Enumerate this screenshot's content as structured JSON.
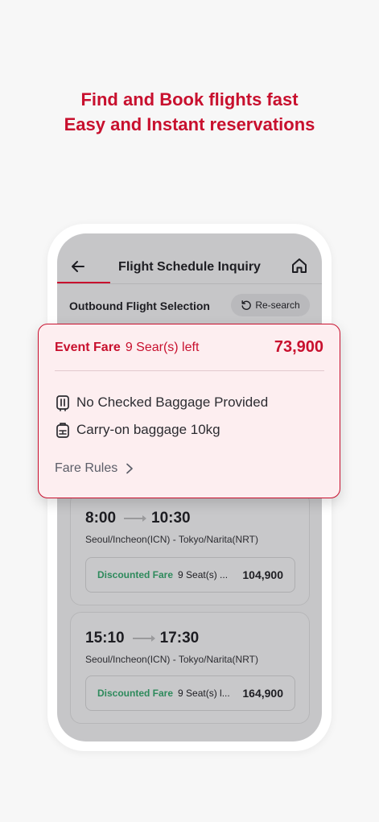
{
  "headline": {
    "line1": "Find and Book flights fast",
    "line2": "Easy and Instant reservations"
  },
  "appbar": {
    "title": "Flight Schedule Inquiry",
    "back_icon": "arrow-left-icon",
    "home_icon": "home-icon"
  },
  "section": {
    "title": "Outbound Flight Selection",
    "research_label": "Re-search",
    "research_icon": "refresh-icon"
  },
  "popup": {
    "fare_label": "Event Fare",
    "seats_left": "9 Sear(s) left",
    "price": "73,900",
    "features": [
      {
        "icon": "baggage-icon",
        "label": "No Checked Baggage Provided"
      },
      {
        "icon": "carry-on-bag-icon",
        "label": "Carry-on baggage 10kg"
      }
    ],
    "fare_rules_label": "Fare Rules"
  },
  "flights": [
    {
      "depart": "8:00",
      "arrive": "10:30",
      "route": "Seoul/Incheon(ICN) - Tokyo/Narita(NRT)",
      "fare_label": "Discounted Fare",
      "seats": "9 Seat(s) ...",
      "price": "104,900"
    },
    {
      "depart": "15:10",
      "arrive": "17:30",
      "route": "Seoul/Incheon(ICN) - Tokyo/Narita(NRT)",
      "fare_label": "Discounted Fare",
      "seats": "9 Seat(s) l...",
      "price": "164,900"
    }
  ],
  "colors": {
    "brand": "#c8102e",
    "discount": "#2e8a5c",
    "popup_bg": "#fdeef0"
  }
}
